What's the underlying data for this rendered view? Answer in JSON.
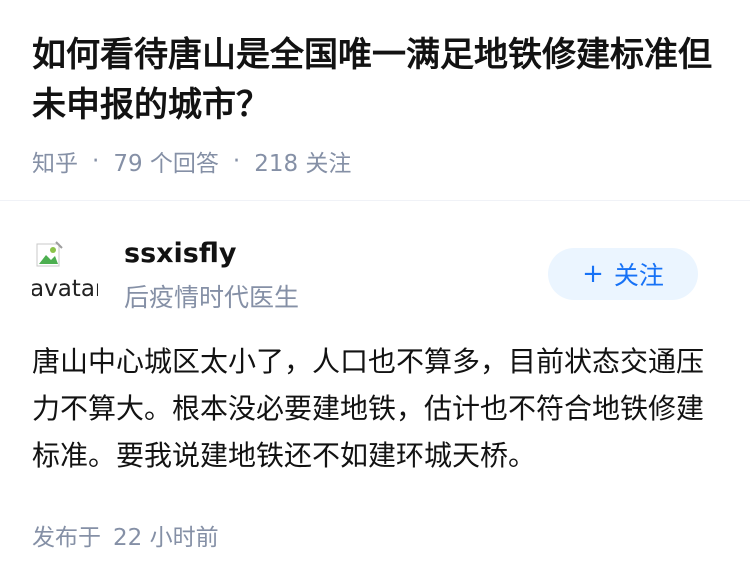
{
  "question": {
    "title": "如何看待唐山是全国唯一满足地铁修建标准但未申报的城市？",
    "source": "知乎",
    "separator": "·",
    "answers_count": "79 个回答",
    "followers_count": "218 关注"
  },
  "answer": {
    "author": {
      "avatar_alt": "avatar",
      "name": "ssxisfly",
      "bio": "后疫情时代医生"
    },
    "follow_button": {
      "icon": "+",
      "label": "关注"
    },
    "content": "唐山中心城区太小了，人口也不算多，目前状态交通压力不算大。根本没必要建地铁，估计也不符合地铁修建标准。要我说建地铁还不如建环城天桥。",
    "published_prefix": "发布于",
    "published_time": "22 小时前"
  },
  "colors": {
    "text_primary": "#121212",
    "text_secondary": "#8590a6",
    "accent": "#1772f6",
    "follow_bg": "#ebf5ff"
  }
}
